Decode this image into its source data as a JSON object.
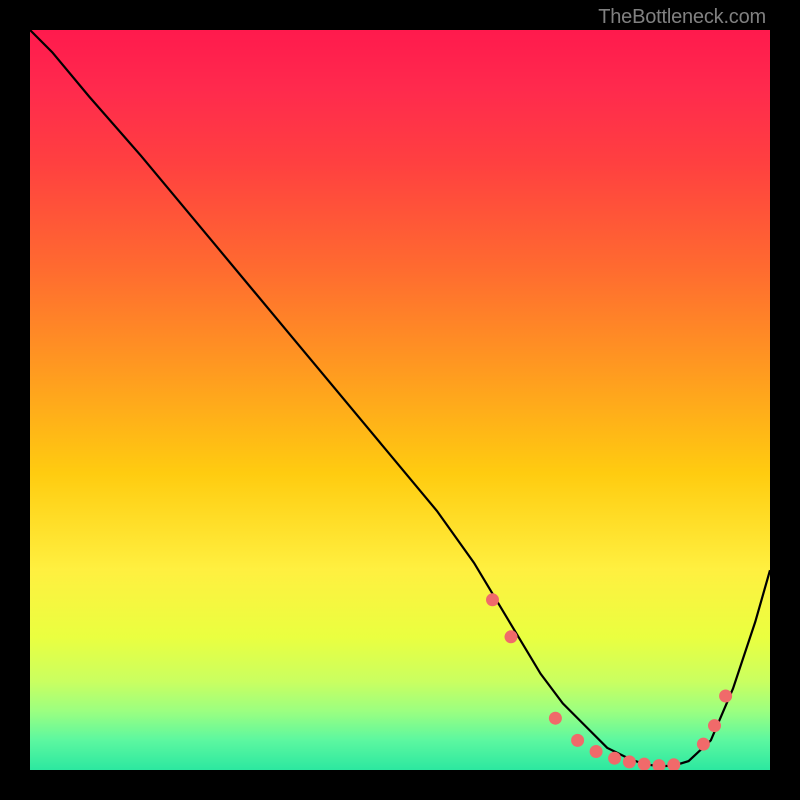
{
  "watermark": "TheBottleneck.com",
  "colors": {
    "curve_stroke": "#000000",
    "dot_fill": "#f06a6a",
    "gradient_top": "#ff1a4d",
    "gradient_mid": "#ffcc10",
    "gradient_bottom": "#2ce8a0"
  },
  "chart_data": {
    "type": "line",
    "title": "",
    "xlabel": "",
    "ylabel": "",
    "xlim": [
      0,
      100
    ],
    "ylim": [
      0,
      100
    ],
    "grid": false,
    "legend": false,
    "series": [
      {
        "name": "bottleneck-curve",
        "x": [
          0,
          3,
          8,
          15,
          25,
          35,
          45,
          55,
          60,
          63,
          66,
          69,
          72,
          75,
          78,
          81,
          83,
          85,
          87,
          89,
          92,
          95,
          98,
          100
        ],
        "y": [
          100,
          97,
          91,
          83,
          71,
          59,
          47,
          35,
          28,
          23,
          18,
          13,
          9,
          6,
          3,
          1.5,
          0.8,
          0.5,
          0.6,
          1.2,
          4,
          11,
          20,
          27
        ]
      }
    ],
    "markers": [
      {
        "x": 62.5,
        "y": 23
      },
      {
        "x": 65,
        "y": 18
      },
      {
        "x": 71,
        "y": 7
      },
      {
        "x": 74,
        "y": 4
      },
      {
        "x": 76.5,
        "y": 2.5
      },
      {
        "x": 79,
        "y": 1.6
      },
      {
        "x": 81,
        "y": 1.1
      },
      {
        "x": 83,
        "y": 0.8
      },
      {
        "x": 85,
        "y": 0.6
      },
      {
        "x": 87,
        "y": 0.7
      },
      {
        "x": 91,
        "y": 3.5
      },
      {
        "x": 92.5,
        "y": 6
      },
      {
        "x": 94,
        "y": 10
      }
    ]
  }
}
